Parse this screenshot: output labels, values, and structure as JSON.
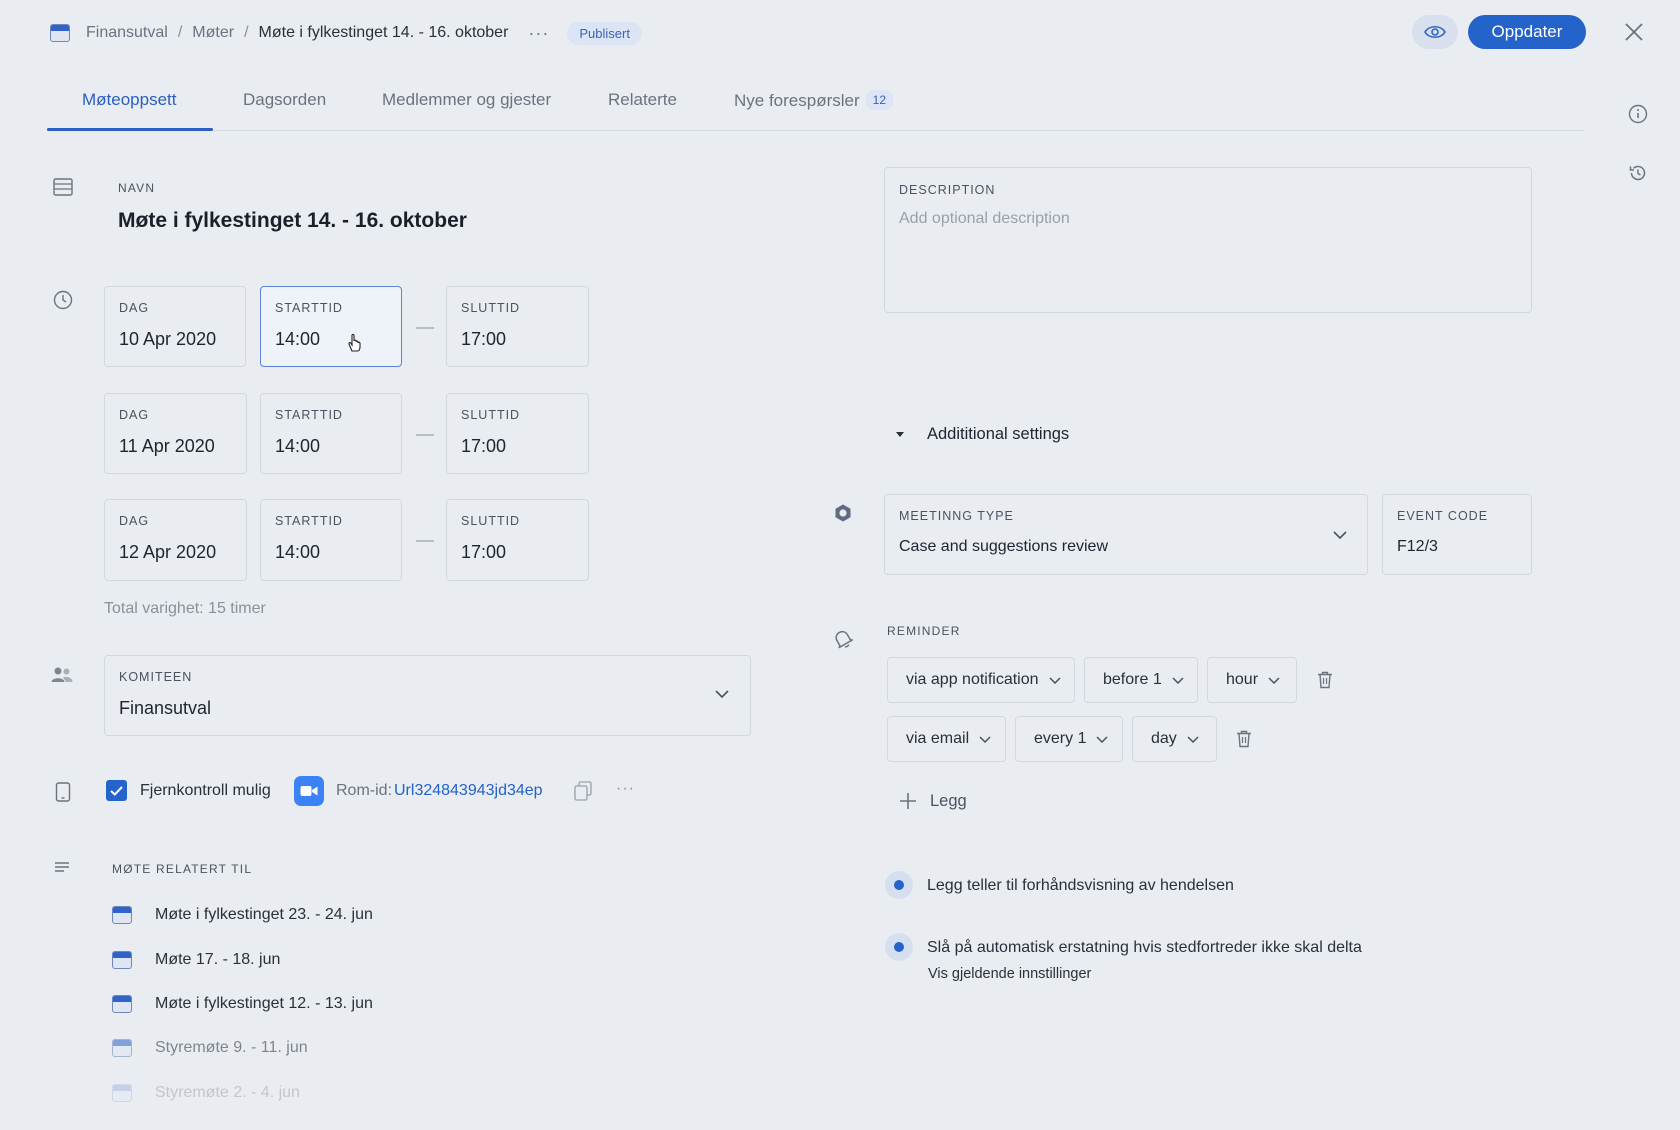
{
  "header": {
    "breadcrumb": [
      "Finansutval",
      "Møter",
      "Møte i fylkestinget 14. - 16. oktober"
    ],
    "more_label": "···",
    "status_badge": "Publisert",
    "update_label": "Oppdater"
  },
  "tabs": [
    {
      "label": "Møteoppsett",
      "active": true
    },
    {
      "label": "Dagsorden"
    },
    {
      "label": "Medlemmer og gjester"
    },
    {
      "label": "Relaterte"
    },
    {
      "label": "Nye forespørsler",
      "count": "12"
    }
  ],
  "name": {
    "label": "NAVN",
    "value": "Møte i fylkestinget 14. - 16. oktober"
  },
  "schedule": {
    "day_label": "DAG",
    "start_label": "STARTTID",
    "end_label": "SLUTTID",
    "rows": [
      {
        "day": "10 Apr 2020",
        "start": "14:00",
        "end": "17:00"
      },
      {
        "day": "11 Apr 2020",
        "start": "14:00",
        "end": "17:00"
      },
      {
        "day": "12 Apr 2020",
        "start": "14:00",
        "end": "17:00"
      }
    ],
    "total": "Total varighet: 15 timer"
  },
  "committee": {
    "label": "KOMITEEN",
    "value": "Finansutval"
  },
  "remote": {
    "checkbox_label": "Fjernkontroll mulig",
    "room_prefix": "Rom-id:",
    "room_id": "Url324843943jd34ep",
    "more_label": "···"
  },
  "related": {
    "label": "MØTE RELATERT TIL",
    "items": [
      "Møte i fylkestinget 23. - 24. jun",
      "Møte 17. - 18. jun",
      "Møte i fylkestinget 12. - 13. jun",
      "Styremøte 9. - 11. jun",
      "Styremøte 2. - 4. jun"
    ]
  },
  "description": {
    "label": "DESCRIPTION",
    "placeholder": "Add optional description"
  },
  "additional": {
    "label": "Addititional settings"
  },
  "meeting_type": {
    "label": "MEETINNG TYPE",
    "value": "Case and suggestions review"
  },
  "event_code": {
    "label": "EVENT CODE",
    "value": "F12/3"
  },
  "reminder": {
    "label": "REMINDER",
    "rows": [
      {
        "channel": "via app notification",
        "when": "before 1",
        "unit": "hour"
      },
      {
        "channel": "via email",
        "when": "every 1",
        "unit": "day"
      }
    ],
    "add_label": "Legg"
  },
  "options": {
    "counter": "Legg teller til forhåndsvisning av hendelsen",
    "auto_replace": "Slå på automatisk erstatning hvis stedfortreder ikke skal delta",
    "settings_link": "Vis gjeldende innstillinger"
  },
  "colors": {
    "accent": "#2463c9",
    "background": "#e9ecf1",
    "badge_bg": "#dce5f5"
  }
}
